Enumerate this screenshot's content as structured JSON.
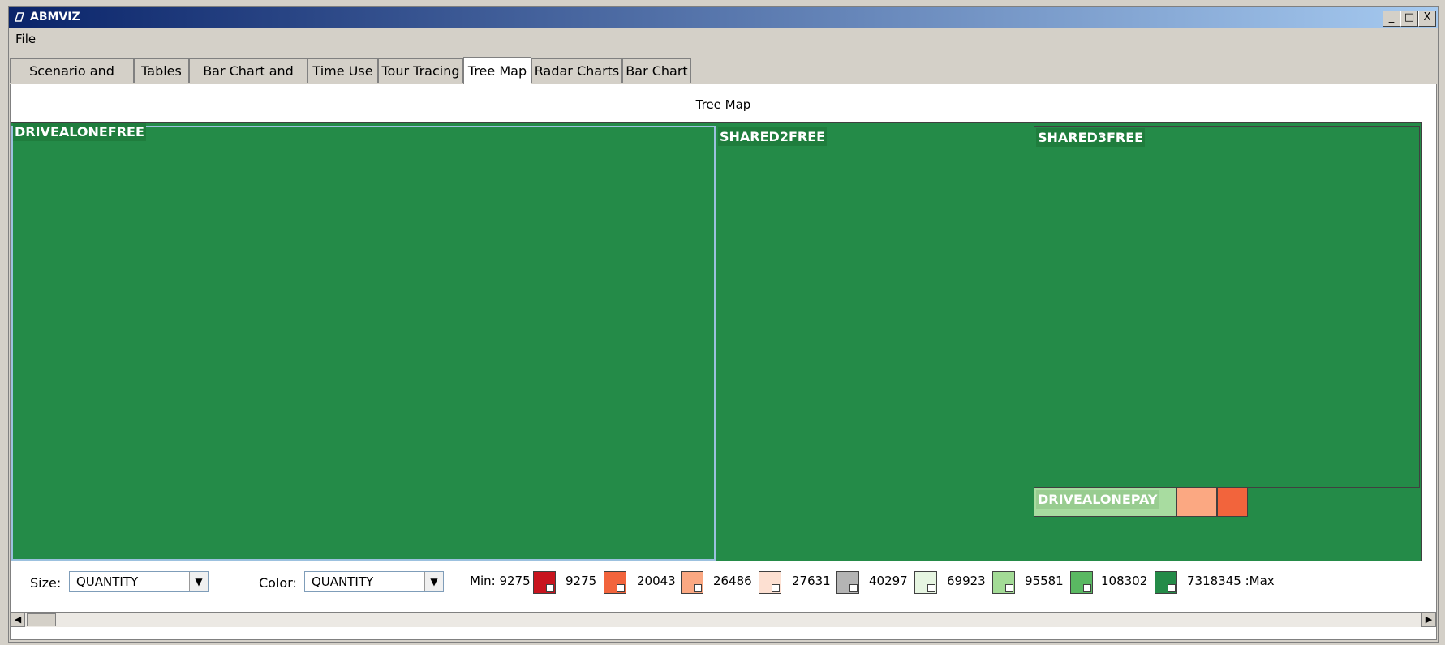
{
  "window": {
    "title": "ABMVIZ",
    "controls": [
      "_",
      "□",
      "X"
    ]
  },
  "menu": {
    "file": "File"
  },
  "tabs": [
    {
      "label": "Scenario and Query"
    },
    {
      "label": "Tables"
    },
    {
      "label": "Bar Chart and Map"
    },
    {
      "label": "Time Use"
    },
    {
      "label": "Tour Tracing"
    },
    {
      "label": "Tree Map"
    },
    {
      "label": "Radar Charts"
    },
    {
      "label": "Bar Chart"
    }
  ],
  "active_tab": "Tree Map",
  "panel": {
    "title": "Tree Map"
  },
  "treemap": {
    "cells": [
      {
        "label": "DRIVEALONEFREE"
      },
      {
        "label": "SHARED2FREE"
      },
      {
        "label": "SHARED3FREE"
      },
      {
        "label": "DRIVEALONEPAY"
      }
    ]
  },
  "controls": {
    "size_label": "Size:",
    "size_value": "QUANTITY",
    "color_label": "Color:",
    "color_value": "QUANTITY"
  },
  "legend": {
    "min_label": "Min: 9275",
    "max_label": "7318345 :Max",
    "steps": [
      {
        "value": "9275",
        "color": "#c8141e"
      },
      {
        "value": "20043",
        "color": "#f2643c"
      },
      {
        "value": "26486",
        "color": "#fba882"
      },
      {
        "value": "27631",
        "color": "#fde0d2"
      },
      {
        "value": "40297",
        "color": "#b4b4b4"
      },
      {
        "value": "69923",
        "color": "#e6f5e1"
      },
      {
        "value": "95581",
        "color": "#a3db96"
      },
      {
        "value": "108302",
        "color": "#5ab862"
      },
      {
        "value": "",
        "color": "#248b48"
      }
    ]
  },
  "colors": {
    "treemap_green": "#248b48",
    "drivealonepay_light": "#a8dca0",
    "peach": "#fba882",
    "orange_red": "#f2643c"
  }
}
